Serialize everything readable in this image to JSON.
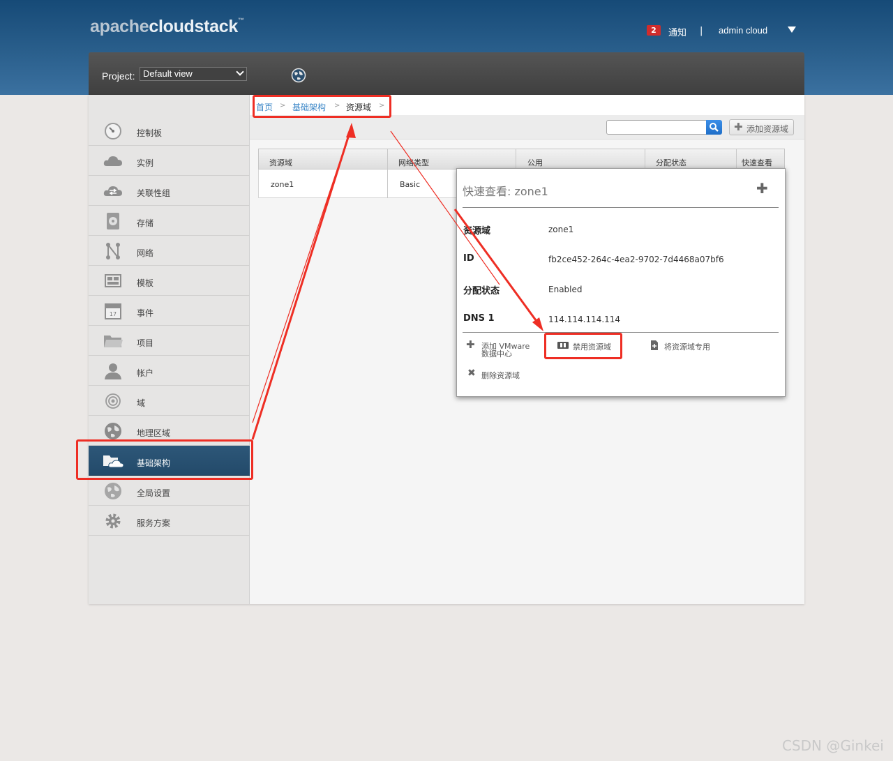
{
  "brand": {
    "part1": "apache",
    "part2": "cloudstack",
    "tm": "™"
  },
  "header": {
    "notification_count": "2",
    "notification_label": "通知",
    "separator": "|",
    "user_name": "admin cloud"
  },
  "project": {
    "label": "Project:",
    "selected": "Default view"
  },
  "sidebar": {
    "items": [
      {
        "label": "控制板",
        "icon": "dashboard-icon"
      },
      {
        "label": "实例",
        "icon": "cloud-icon"
      },
      {
        "label": "关联性组",
        "icon": "affinity-cloud-icon"
      },
      {
        "label": "存储",
        "icon": "disk-icon"
      },
      {
        "label": "网络",
        "icon": "network-icon"
      },
      {
        "label": "模板",
        "icon": "template-icon"
      },
      {
        "label": "事件",
        "icon": "calendar-icon"
      },
      {
        "label": "项目",
        "icon": "folder-icon"
      },
      {
        "label": "帐户",
        "icon": "user-icon"
      },
      {
        "label": "域",
        "icon": "domain-icon"
      },
      {
        "label": "地理区域",
        "icon": "globe-icon"
      },
      {
        "label": "基础架构",
        "icon": "infrastructure-icon"
      },
      {
        "label": "全局设置",
        "icon": "global-settings-icon"
      },
      {
        "label": "服务方案",
        "icon": "gear-icon"
      }
    ],
    "active_index": 11
  },
  "breadcrumb": {
    "home": "首页",
    "infra": "基础架构",
    "current": "资源域",
    "gt": ">"
  },
  "toolbar": {
    "search_value": "",
    "add_zone_label": "添加资源域"
  },
  "table": {
    "columns": [
      "资源域",
      "网络类型",
      "公用",
      "分配状态",
      "快速查看"
    ],
    "rows": [
      {
        "zone": "zone1",
        "network_type": "Basic"
      }
    ]
  },
  "quickview": {
    "title": "快速查看: zone1",
    "fields": [
      {
        "label": "资源域",
        "value": "zone1"
      },
      {
        "label": "ID",
        "value": "fb2ce452-264c-4ea2-9702-7d4468a07bf6"
      },
      {
        "label": "分配状态",
        "value": "Enabled"
      },
      {
        "label": "DNS 1",
        "value": "114.114.114.114"
      }
    ],
    "actions": {
      "add_vmware_line1": "添加 VMware",
      "add_vmware_line2": "数据中心",
      "disable_zone": "禁用资源域",
      "dedicate_zone": "将资源域专用",
      "delete_zone": "删除资源域"
    }
  },
  "colors": {
    "accent_red": "#ee2e24",
    "active_nav": "#2d5778",
    "link_blue": "#3a86c7"
  },
  "watermark": "CSDN @Ginkei"
}
